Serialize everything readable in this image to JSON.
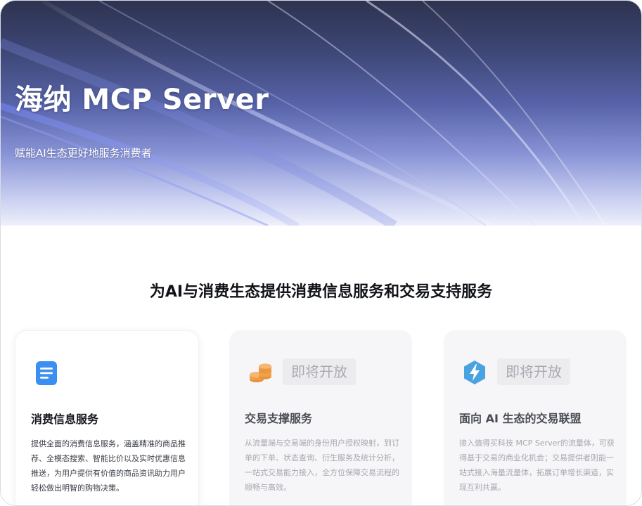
{
  "hero": {
    "title": "海纳 MCP Server",
    "subtitle": "赋能AI生态更好地服务消费者"
  },
  "main": {
    "headline": "为AI与消费生态提供消费信息服务和交易支持服务"
  },
  "cards": [
    {
      "title": "消费信息服务",
      "description": "提供全面的消费信息服务，涵盖精准的商品推荐、全模态搜索、智能比价以及实时优惠信息推送，为用户提供有价值的商品资讯助力用户轻松做出明智的购物决策。",
      "icon": "document-icon",
      "icon_color": "#3b8ff0"
    },
    {
      "title": "交易支撑服务",
      "badge": "即将开放",
      "description": "从流量端与交易端的身份用户授权映射，到订单的下单、状态查询、衍生服务及统计分析，一站式交易能力接入，全方位保障交易流程的顺畅与高效。",
      "icon": "coins-icon",
      "icon_color": "#f0a04b"
    },
    {
      "title": "面向 AI 生态的交易联盟",
      "badge": "即将开放",
      "description": "接入值得买科技 MCP Server的流量体，可获得基于交易的商业化机会；交易提供者则能一站式接入海量流量体，拓展订单增长渠道，实现互利共赢。",
      "icon": "lightning-hexagon-icon",
      "icon_color": "#4aa3e0"
    }
  ],
  "colors": {
    "hero_dark": "#2e3350",
    "hero_mid": "#5763a8",
    "hero_light": "#c9cff1"
  }
}
